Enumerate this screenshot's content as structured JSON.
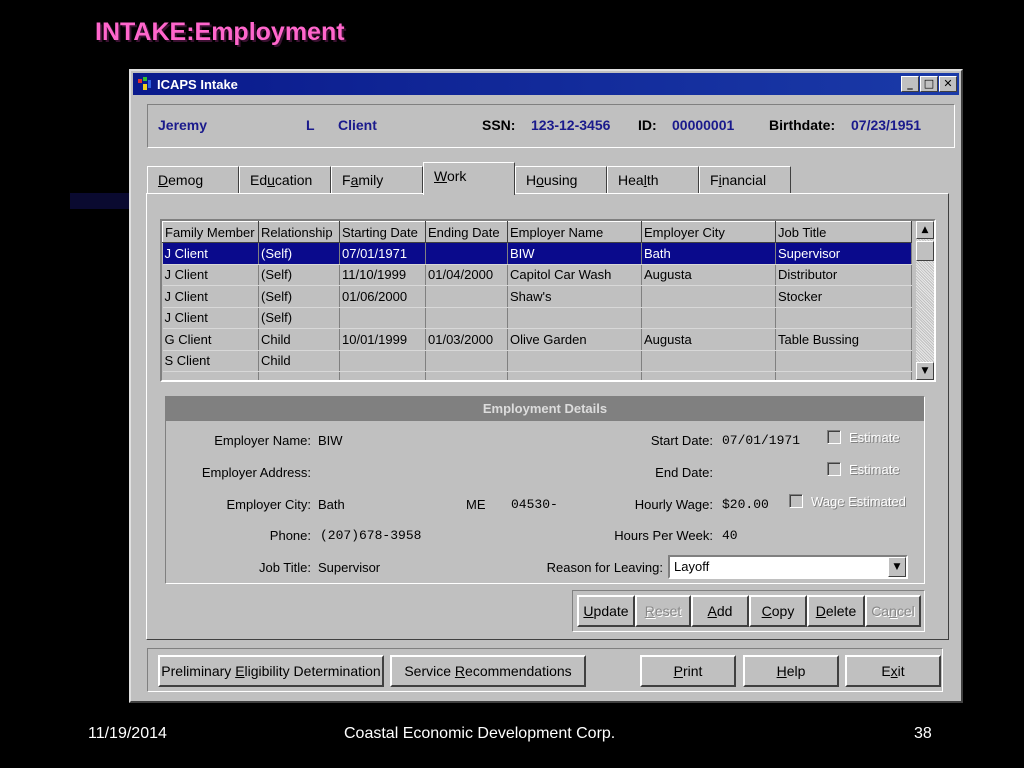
{
  "slide": {
    "title": "INTAKE:Employment",
    "footer_date": "11/19/2014",
    "footer_org": "Coastal Economic Development Corp.",
    "footer_page": "38"
  },
  "window": {
    "title": "ICAPS Intake",
    "controls": [
      "_",
      "□",
      "✕"
    ]
  },
  "client": {
    "first_name": "Jeremy",
    "middle_initial": "L",
    "last_name": "Client",
    "ssn_label": "SSN:",
    "ssn": "123-12-3456",
    "id_label": "ID:",
    "id": "00000001",
    "birthdate_label": "Birthdate:",
    "birthdate": "07/23/1951"
  },
  "tabs": [
    {
      "pre": "",
      "key": "D",
      "post": "emog"
    },
    {
      "pre": "Ed",
      "key": "u",
      "post": "cation"
    },
    {
      "pre": "F",
      "key": "a",
      "post": "mily"
    },
    {
      "pre": "",
      "key": "W",
      "post": "ork"
    },
    {
      "pre": "H",
      "key": "o",
      "post": "using"
    },
    {
      "pre": "Hea",
      "key": "l",
      "post": "th"
    },
    {
      "pre": "F",
      "key": "i",
      "post": "nancial"
    }
  ],
  "grid": {
    "columns": [
      "Family Member",
      "Relationship",
      "Starting Date",
      "Ending Date",
      "Employer Name",
      "Employer City",
      "Job Title"
    ],
    "rows": [
      [
        "J Client",
        "(Self)",
        "07/01/1971",
        "",
        "BIW",
        "Bath",
        "Supervisor"
      ],
      [
        "J Client",
        "(Self)",
        "11/10/1999",
        "01/04/2000",
        "Capitol Car Wash",
        "Augusta",
        "Distributor"
      ],
      [
        "J Client",
        "(Self)",
        "01/06/2000",
        "",
        "Shaw's",
        "",
        "Stocker"
      ],
      [
        "J Client",
        "(Self)",
        "",
        "",
        "",
        "",
        ""
      ],
      [
        "G Client",
        "Child",
        "10/01/1999",
        "01/03/2000",
        "Olive Garden",
        "Augusta",
        "Table Bussing"
      ],
      [
        "S Client",
        "Child",
        "",
        "",
        "",
        "",
        ""
      ],
      [
        "",
        "",
        "",
        "",
        "",
        "",
        ""
      ]
    ],
    "selected_row": 0
  },
  "details": {
    "heading": "Employment Details",
    "employer_name_label": "Employer Name:",
    "employer_name": "BIW",
    "employer_address_label": "Employer Address:",
    "employer_address": "",
    "employer_city_label": "Employer City:",
    "employer_city": "Bath",
    "state": "ME",
    "zip": "04530-",
    "phone_label": "Phone:",
    "phone": "(207)678-3958",
    "job_title_label": "Job Title:",
    "job_title": "Supervisor",
    "start_date_label": "Start Date:",
    "start_date": "07/01/1971",
    "end_date_label": "End Date:",
    "end_date": "",
    "hourly_wage_label": "Hourly Wage:",
    "hourly_wage": "$20.00",
    "hours_per_week_label": "Hours Per Week:",
    "hours_per_week": "40",
    "reason_label": "Reason for Leaving:",
    "reason": "Layoff",
    "estimate_label_1": "Estimate",
    "estimate_label_2": "Estimate",
    "wage_estimated_label": "Wage Estimated"
  },
  "actions": {
    "update": {
      "pre": "",
      "key": "U",
      "post": "pdate"
    },
    "reset": {
      "pre": "",
      "key": "R",
      "post": "eset"
    },
    "add": {
      "pre": "",
      "key": "A",
      "post": "dd"
    },
    "copy": {
      "pre": "",
      "key": "C",
      "post": "opy"
    },
    "delete": {
      "pre": "",
      "key": "D",
      "post": "elete"
    },
    "cancel": {
      "pre": "Ca",
      "key": "n",
      "post": "cel"
    }
  },
  "bottom": {
    "eligibility": {
      "pre": "Preliminary ",
      "key": "E",
      "post": "ligibility Determination"
    },
    "service": {
      "pre": "Service ",
      "key": "R",
      "post": "ecommendations"
    },
    "print": {
      "pre": "",
      "key": "P",
      "post": "rint"
    },
    "help": {
      "pre": "",
      "key": "H",
      "post": "elp"
    },
    "exit": {
      "pre": "E",
      "key": "x",
      "post": "it"
    }
  }
}
